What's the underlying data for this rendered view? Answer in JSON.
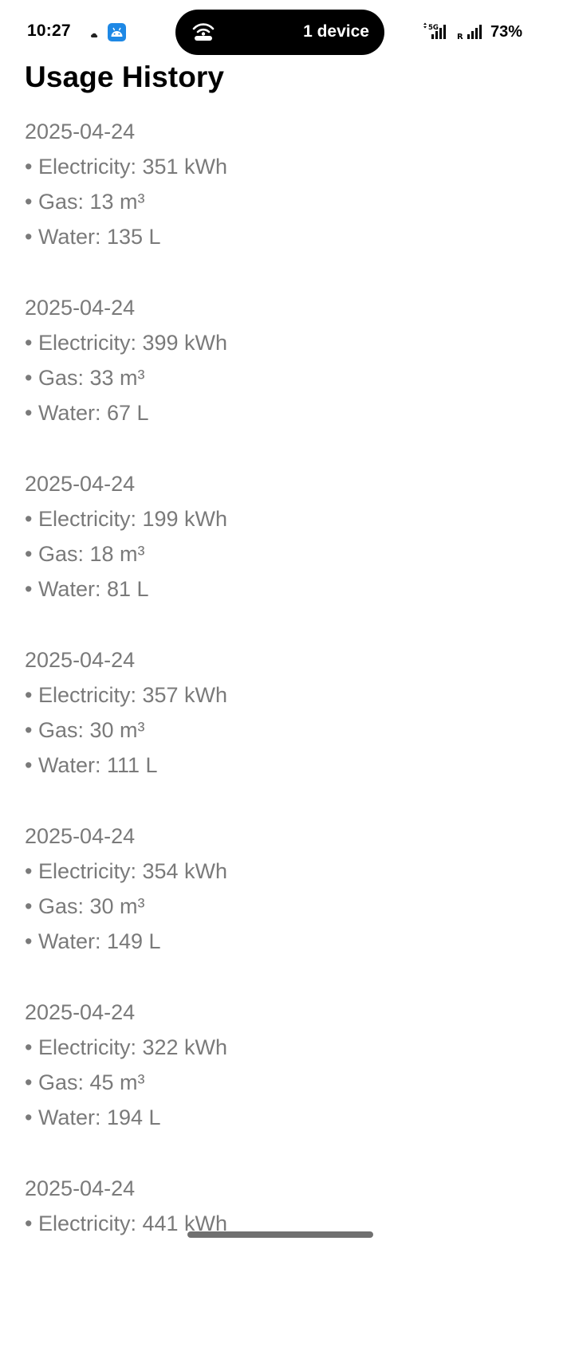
{
  "status_bar": {
    "time": "10:27",
    "island_text": "1 device",
    "network": "5G",
    "roaming": "R",
    "battery": "73%",
    "icons": [
      "cloud-icon",
      "android-app-icon",
      "hotspot-icon",
      "signal-icon",
      "battery-icon"
    ]
  },
  "page": {
    "title": "Usage History"
  },
  "history": [
    {
      "date": "2025-04-24",
      "electricity": "• Electricity: 351 kWh",
      "gas": "• Gas: 13 m³",
      "water": "• Water: 135 L"
    },
    {
      "date": "2025-04-24",
      "electricity": "• Electricity: 399 kWh",
      "gas": "• Gas: 33 m³",
      "water": "• Water: 67 L"
    },
    {
      "date": "2025-04-24",
      "electricity": "• Electricity: 199 kWh",
      "gas": "• Gas: 18 m³",
      "water": "• Water: 81 L"
    },
    {
      "date": "2025-04-24",
      "electricity": "• Electricity: 357 kWh",
      "gas": "• Gas: 30 m³",
      "water": "• Water: 111 L"
    },
    {
      "date": "2025-04-24",
      "electricity": "• Electricity: 354 kWh",
      "gas": "• Gas: 30 m³",
      "water": "• Water: 149 L"
    },
    {
      "date": "2025-04-24",
      "electricity": "• Electricity: 322 kWh",
      "gas": "• Gas: 45 m³",
      "water": "• Water: 194 L"
    },
    {
      "date": "2025-04-24",
      "electricity": "• Electricity: 441 kWh"
    }
  ],
  "colors": {
    "text_secondary": "#7a7a7a",
    "island": "#000000",
    "app_badge": "#1e88e5",
    "home_indicator": "#707070"
  }
}
